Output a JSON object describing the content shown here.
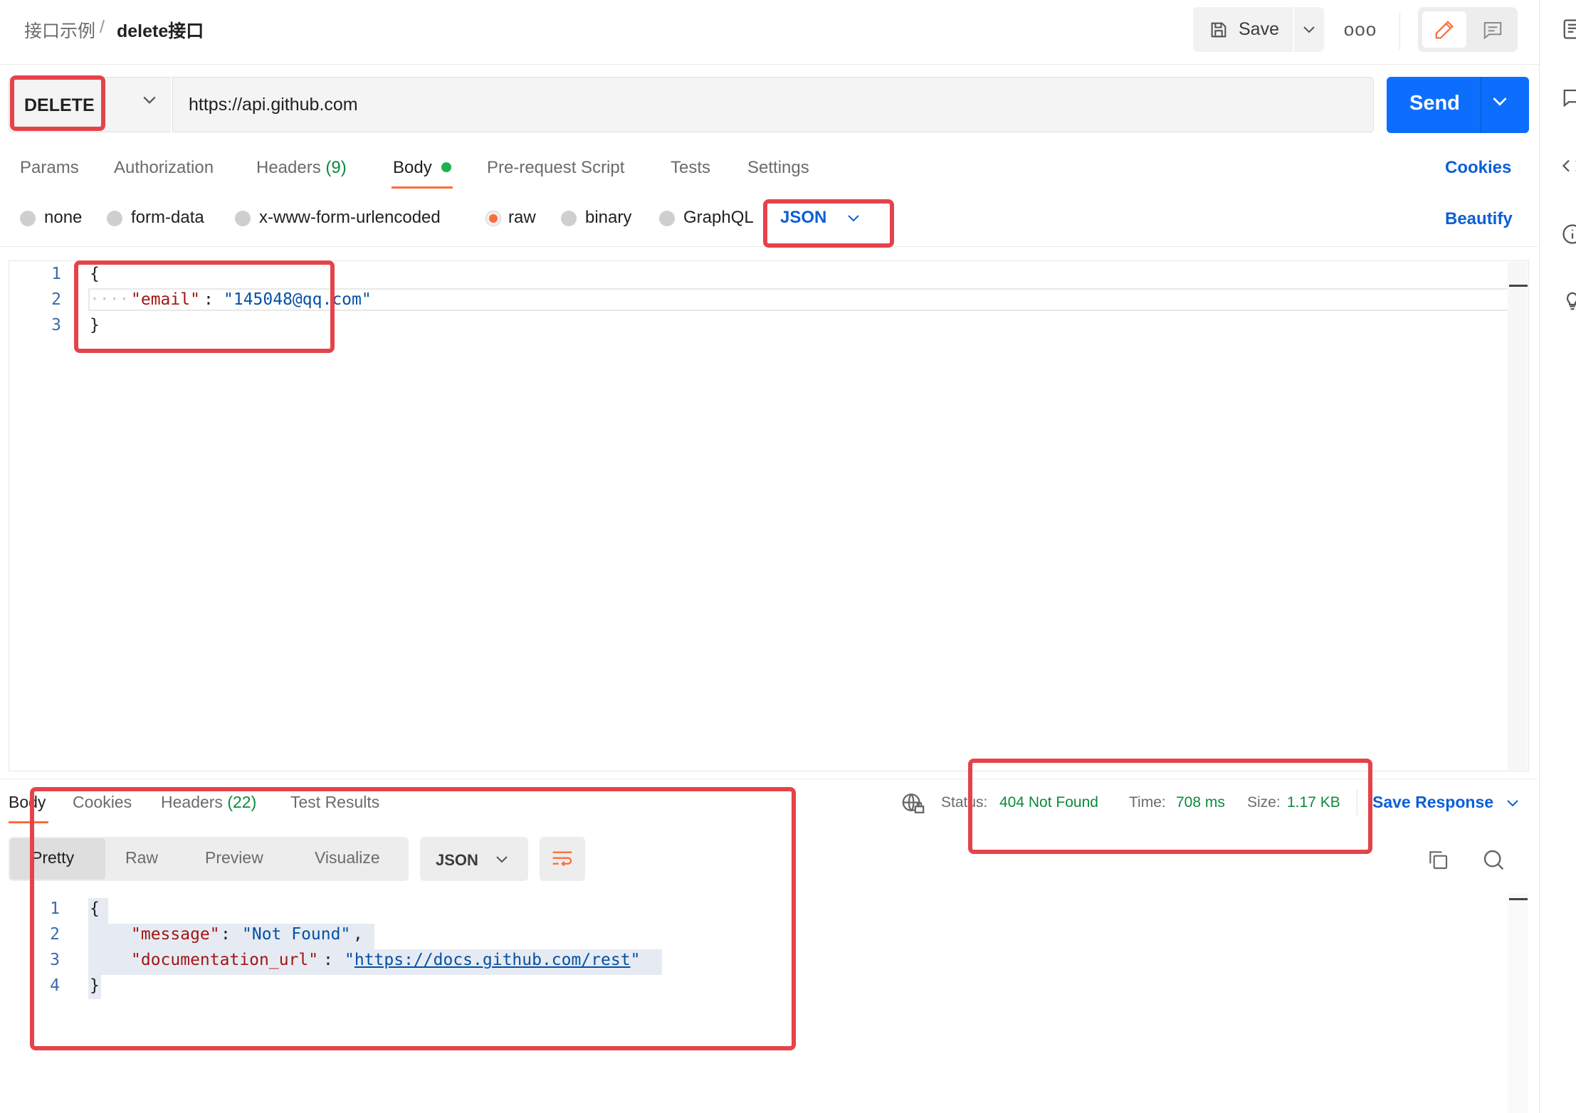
{
  "breadcrumb": {
    "parent": "接口示例",
    "separator": "/",
    "current": "delete接口"
  },
  "toolbar": {
    "save_label": "Save",
    "more_label": "ooo"
  },
  "request": {
    "method": "DELETE",
    "url": "https://api.github.com",
    "send_label": "Send"
  },
  "tabs": {
    "params": "Params",
    "authorization": "Authorization",
    "headers": "Headers",
    "headers_count": "(9)",
    "body": "Body",
    "pre_request": "Pre-request Script",
    "tests": "Tests",
    "settings": "Settings",
    "cookies_link": "Cookies"
  },
  "body_types": {
    "none": "none",
    "form_data": "form-data",
    "urlencoded": "x-www-form-urlencoded",
    "raw": "raw",
    "binary": "binary",
    "graphql": "GraphQL",
    "selected": "raw",
    "format": "JSON",
    "beautify": "Beautify"
  },
  "request_body": {
    "line_numbers": [
      "1",
      "2",
      "3"
    ],
    "open": "{",
    "key": "\"email\"",
    "colon": ":",
    "value": "\"145048@qq.com\"",
    "close": "}"
  },
  "response": {
    "tabs": {
      "body": "Body",
      "cookies": "Cookies",
      "headers": "Headers",
      "headers_count": "(22)",
      "test_results": "Test Results"
    },
    "status_label": "Status:",
    "status_value": "404 Not Found",
    "time_label": "Time:",
    "time_value": "708 ms",
    "size_label": "Size:",
    "size_value": "1.17 KB",
    "save_response": "Save Response",
    "views": {
      "pretty": "Pretty",
      "raw": "Raw",
      "preview": "Preview",
      "visualize": "Visualize"
    },
    "format": "JSON",
    "body": {
      "line_numbers": [
        "1",
        "2",
        "3",
        "4"
      ],
      "open": "{",
      "message_key": "\"message\"",
      "message_value": "\"Not Found\"",
      "doc_key": "\"documentation_url\"",
      "doc_value_url": "https://docs.github.com/rest",
      "close": "}"
    }
  },
  "colors": {
    "accent_orange": "#ff6c37",
    "primary_blue": "#0d6efd",
    "status_green": "#0b8a3b",
    "annotation_red": "#e5434a"
  }
}
